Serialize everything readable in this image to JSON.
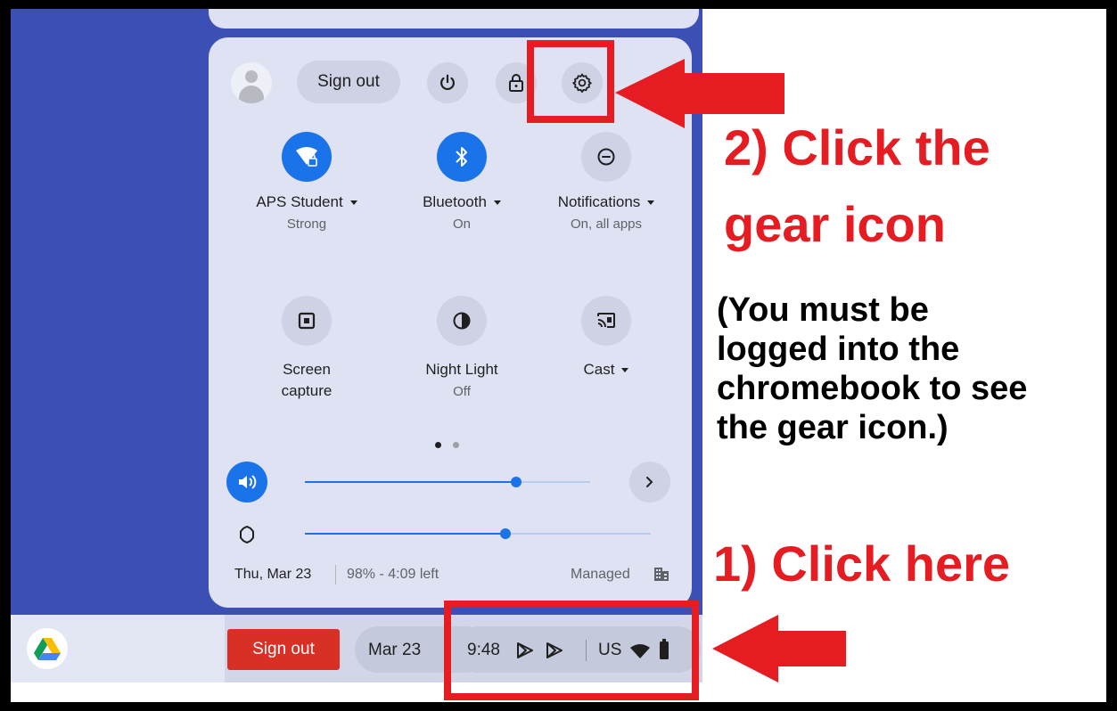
{
  "quick_settings": {
    "sign_out_label": "Sign out",
    "network": {
      "label": "APS Student",
      "sub": "Strong"
    },
    "bluetooth": {
      "label": "Bluetooth",
      "sub": "On"
    },
    "notifications": {
      "label": "Notifications",
      "sub": "On, all apps"
    },
    "screen_capture": {
      "line1": "Screen",
      "line2": "capture"
    },
    "night_light": {
      "label": "Night Light",
      "sub": "Off"
    },
    "cast": {
      "label": "Cast"
    },
    "volume_level": 0.74,
    "brightness_level": 0.58,
    "footer": {
      "date": "Thu, Mar 23",
      "battery": "98% - 4:09 left",
      "managed": "Managed"
    }
  },
  "shelf": {
    "sign_out_label": "Sign out",
    "date": "Mar 23",
    "time": "9:48",
    "ime": "US"
  },
  "annotations": {
    "step2_line1": "2) Click the",
    "step2_line2": "gear icon",
    "note_lines": [
      "(You must be",
      "logged into the",
      "chromebook to see",
      "the gear icon.)"
    ],
    "step1": "1) Click here",
    "arrow_color": "#e51d22"
  },
  "colors": {
    "accent": "#1a73e8",
    "desktop": "#3b4fb4",
    "danger": "#d93025",
    "panel": "#dfe2f3"
  }
}
